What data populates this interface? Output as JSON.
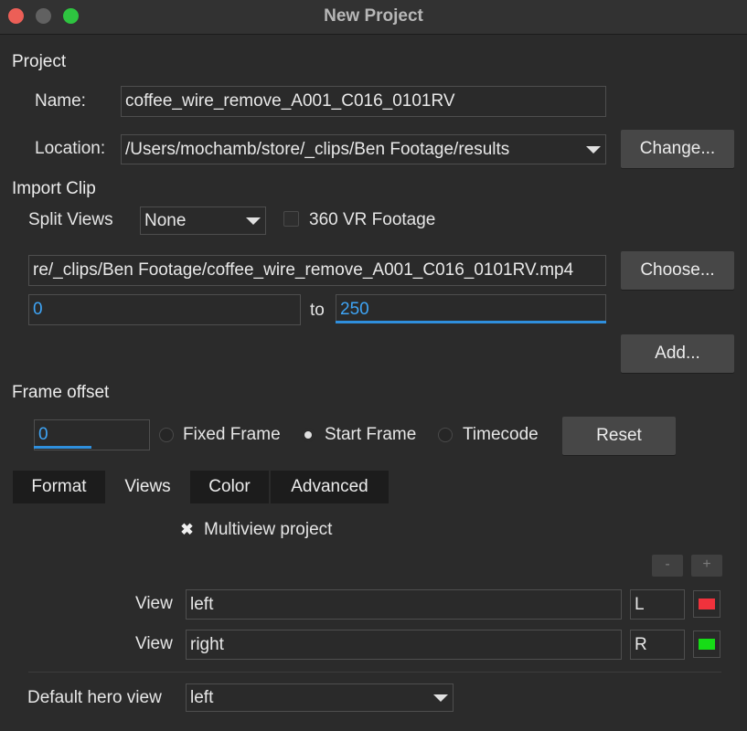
{
  "window": {
    "title": "New Project"
  },
  "project": {
    "heading": "Project",
    "name_label": "Name:",
    "name_value": "coffee_wire_remove_A001_C016_0101RV",
    "location_label": "Location:",
    "location_value": "/Users/mochamb/store/_clips/Ben Footage/results",
    "change_button": "Change..."
  },
  "import_clip": {
    "heading": "Import Clip",
    "split_views_label": "Split Views",
    "split_views_value": "None",
    "vr_label": "360 VR Footage",
    "vr_checked": false,
    "clip_path": "re/_clips/Ben Footage/coffee_wire_remove_A001_C016_0101RV.mp4",
    "choose_button": "Choose...",
    "range_start": "0",
    "range_to_label": "to",
    "range_end": "250",
    "add_button": "Add..."
  },
  "frame_offset": {
    "heading": "Frame offset",
    "value": "0",
    "options": [
      "Fixed Frame",
      "Start Frame",
      "Timecode"
    ],
    "selected": "Start Frame",
    "reset_button": "Reset"
  },
  "tabs": {
    "items": [
      "Format",
      "Views",
      "Color",
      "Advanced"
    ],
    "active": "Views"
  },
  "views": {
    "multiview_label": "Multiview project",
    "multiview_checked": true,
    "minus_label": "-",
    "plus_label": "+",
    "rows": [
      {
        "label": "View",
        "name": "left",
        "short": "L",
        "color": "#f0323c"
      },
      {
        "label": "View",
        "name": "right",
        "short": "R",
        "color": "#16dc16"
      }
    ],
    "default_hero_label": "Default hero view",
    "default_hero_value": "left"
  },
  "colors": {
    "background": "#2b2b2b",
    "accent": "#3ea4f5",
    "close": "#ec5f57",
    "minimize": "#616161",
    "maximize": "#2ec440"
  }
}
